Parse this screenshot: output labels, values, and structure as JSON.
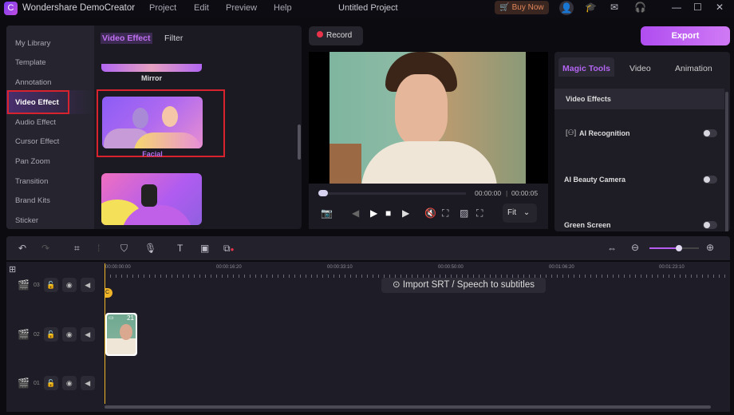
{
  "app": {
    "title": "Wondershare DemoCreator",
    "project_title": "Untitled Project",
    "menu": [
      "Project",
      "Edit",
      "Preview",
      "Help"
    ],
    "buy_now": "Buy Now"
  },
  "left_panel": {
    "sidebar": [
      "My Library",
      "Template",
      "Annotation",
      "Video Effect",
      "Audio Effect",
      "Cursor Effect",
      "Pan Zoom",
      "Transition",
      "Brand Kits",
      "Sticker"
    ],
    "active": "Video Effect",
    "tabs": [
      "Video Effect",
      "Filter"
    ],
    "effects": [
      {
        "label": "Mirror"
      },
      {
        "label": "Facial",
        "selected": true
      },
      {
        "label": ""
      }
    ]
  },
  "toolbar": {
    "record": "Record",
    "export": "Export"
  },
  "preview": {
    "current_time": "00:00:00",
    "duration": "00:00:05",
    "zoom": "Fit",
    "progress": 0
  },
  "right_panel": {
    "tabs": [
      "Magic Tools",
      "Video",
      "Animation"
    ],
    "active_tab": "Magic Tools",
    "section": "Video Effects",
    "items": [
      {
        "label": "AI Recognition",
        "enabled": false
      },
      {
        "label": "AI Beauty Camera",
        "enabled": false
      },
      {
        "label": "Green Screen",
        "enabled": false
      }
    ]
  },
  "timeline": {
    "ruler": [
      "00:00:00:00",
      "00:00:16:20",
      "00:00:33:10",
      "00:00:50:00",
      "00:01:06:20",
      "00:01:23:10"
    ],
    "import_srt": "Import SRT / Speech to subtitles",
    "tracks": [
      {
        "num": "03"
      },
      {
        "num": "02"
      },
      {
        "num": "01"
      }
    ],
    "clip_badge": "21",
    "zoom_level": 0.6
  },
  "colors": {
    "accent": "#b65cf0",
    "record": "#e8334a",
    "playhead": "#f0b429"
  }
}
